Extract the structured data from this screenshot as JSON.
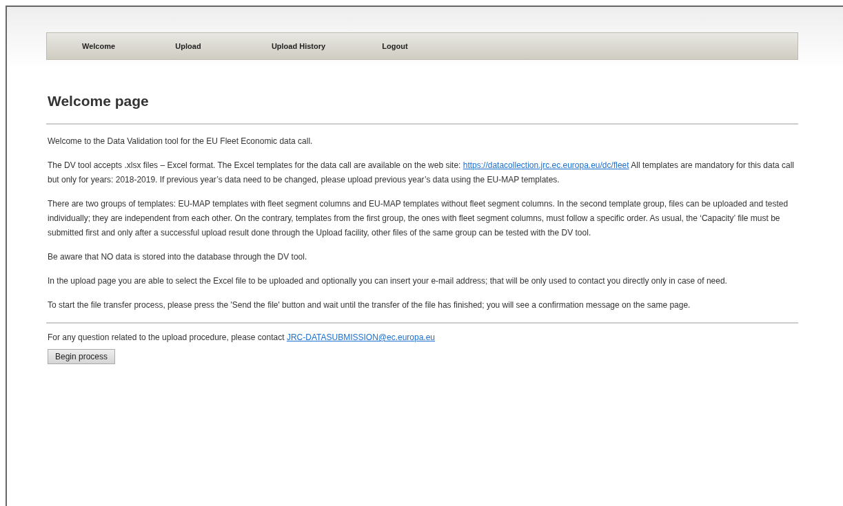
{
  "nav": [
    {
      "label": "Welcome"
    },
    {
      "label": "Upload"
    },
    {
      "label": "Upload History"
    },
    {
      "label": "Logout"
    }
  ],
  "title": "Welcome page",
  "paragraphs": [
    {
      "text": "Welcome to the Data Validation tool for the EU Fleet Economic data call."
    },
    {
      "text": "The DV tool accepts .xlsx files – Excel format. The Excel templates for the data call are available on the web site:",
      "link": "https://datacollection.jrc.ec.europa.eu/dc/fleet",
      "after": " All templates are mandatory for this data call but only for years: 2018-2019. If previous year’s data need to be changed, please upload previous year’s data using the EU-MAP templates."
    },
    {
      "text": "There are two groups of templates: EU-MAP templates with fleet segment columns and EU-MAP templates without fleet segment columns. In the second template group, files can be uploaded and tested individually; they are independent from each other. On the contrary, templates from the first group, the ones with fleet segment columns, must follow a specific order. As usual, the ‘Capacity’ file must be submitted first and only after a successful upload result done through the Upload facility, other files of the same group can be tested with the DV tool."
    },
    {
      "text": "Be aware that NO data is stored into the database through the DV tool."
    },
    {
      "text": "In the upload page you are able to select the Excel file to be uploaded and optionally you can insert your e-mail address; that will be only used to contact you directly only in case of need."
    },
    {
      "text": "To start the file transfer process, please press the 'Send the file' button and wait until the transfer of the file has finished; you will see a confirmation message on the same page."
    }
  ],
  "contact": {
    "text": "For any question related to the upload procedure, please contact ",
    "link": "JRC-DATASUBMISSION@ec.europa.eu"
  },
  "button": "Begin process"
}
